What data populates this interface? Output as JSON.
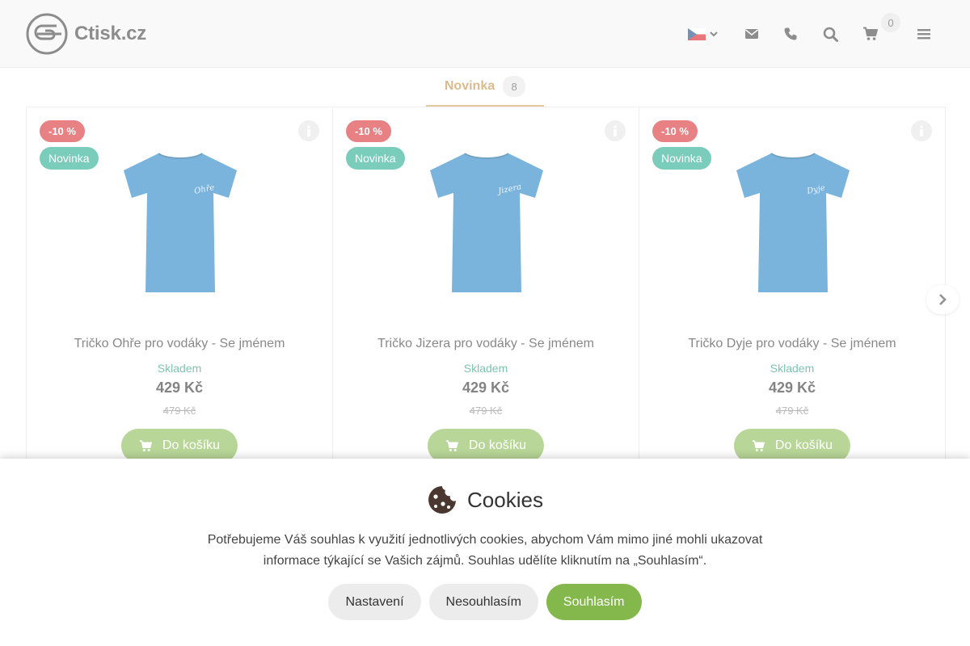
{
  "header": {
    "logo_text": "Ctisk.cz",
    "icons": [
      "cz-flag-icon",
      "chevron-down-icon",
      "envelope-icon",
      "phone-icon",
      "search-icon",
      "cart-icon",
      "menu-icon"
    ],
    "cart_count": "0"
  },
  "tabs": [
    {
      "label": "Novinka",
      "count": "8"
    }
  ],
  "products": [
    {
      "title": "Tričko Ohře pro vodáky - Se jménem",
      "discount": "-10 %",
      "new_label": "Novinka",
      "stock": "Skladem",
      "price": "429 Kč",
      "old_price": "479 Kč",
      "button": "Do košíku",
      "shirt_text": "Ohře"
    },
    {
      "title": "Tričko Jizera pro vodáky - Se jménem",
      "discount": "-10 %",
      "new_label": "Novinka",
      "stock": "Skladem",
      "price": "429 Kč",
      "old_price": "479 Kč",
      "button": "Do košíku",
      "shirt_text": "Jizera"
    },
    {
      "title": "Tričko Dyje pro vodáky - Se jménem",
      "discount": "-10 %",
      "new_label": "Novinka",
      "stock": "Skladem",
      "price": "429 Kč",
      "old_price": "479 Kč",
      "button": "Do košíku",
      "shirt_text": "Dyje"
    }
  ],
  "cookies": {
    "title": "Cookies",
    "text": "Potřebujeme Váš souhlas k využití jednotlivých cookies, abychom Vám mimo jiné mohli ukazovat informace týkající se Vašich zájmů. Souhlas udělíte kliknutím na „Souhlasím“.",
    "buttons": {
      "settings": "Nastavení",
      "decline": "Nesouhlasím",
      "accept": "Souhlasím"
    }
  },
  "colors": {
    "accent_green": "#84b84c",
    "discount_red": "#d7262b",
    "new_teal": "#1aa88a",
    "tab_gold": "#c4883a",
    "shirt_blue": "#1a7fc4"
  }
}
